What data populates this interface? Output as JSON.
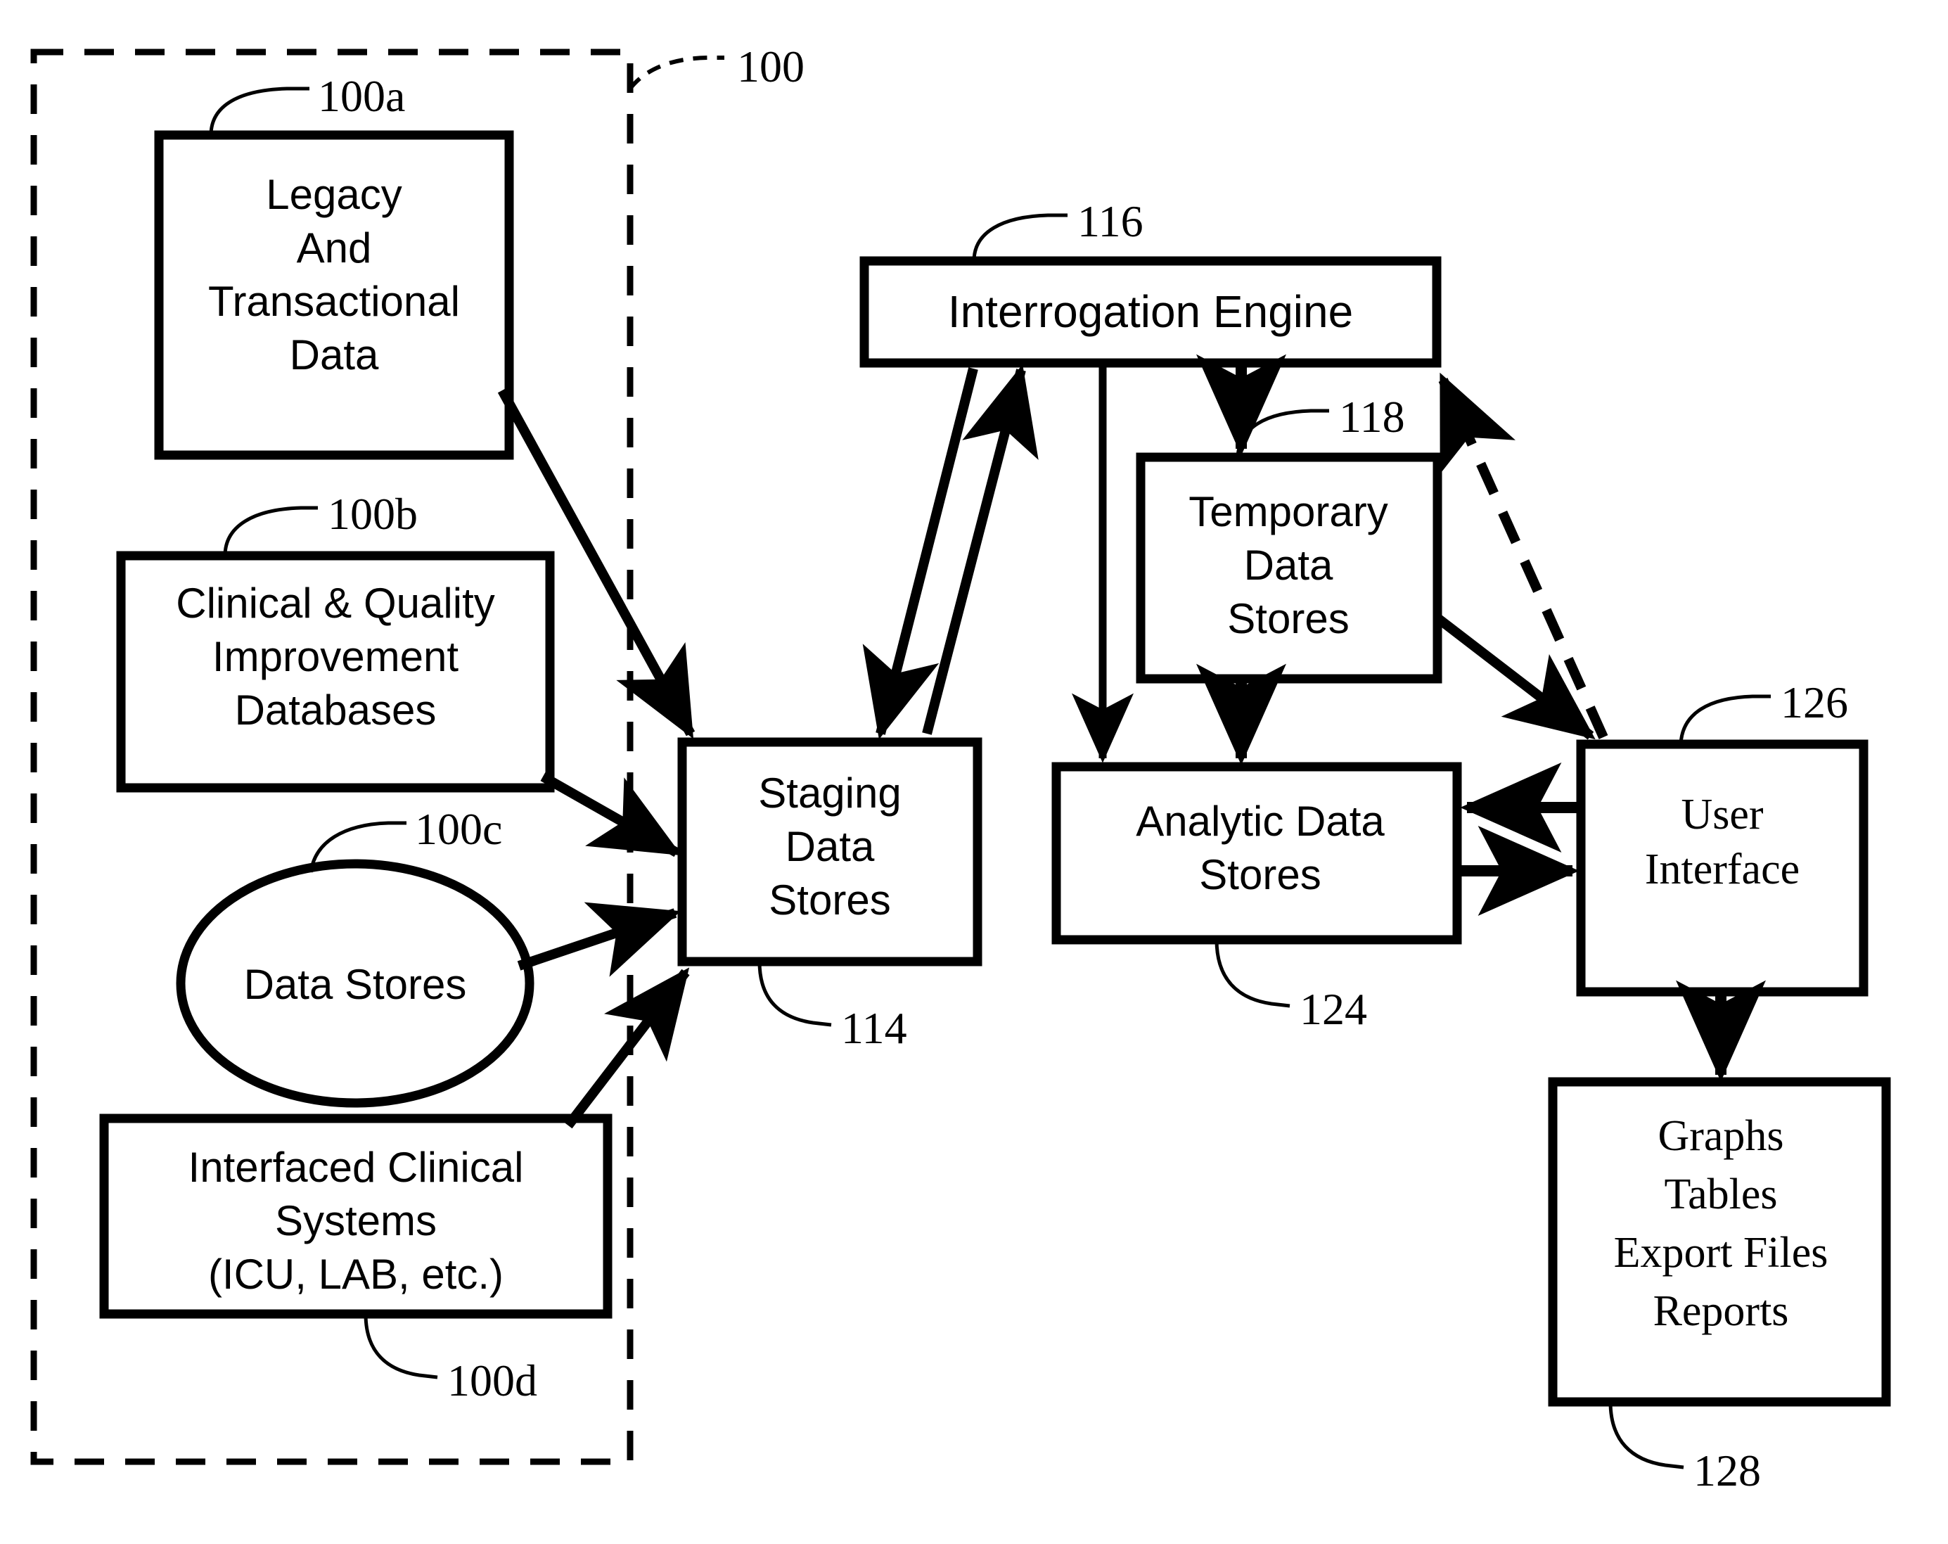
{
  "figure": {
    "type": "patent-block-diagram",
    "background": "#ffffff",
    "ink": "#000000"
  },
  "boundary": {
    "name": "data-sources-boundary",
    "style": "dashed",
    "ref": "100"
  },
  "nodes": {
    "legacy": {
      "ref": "100a",
      "shape": "rect",
      "lines": [
        "Legacy",
        "And",
        "Transactional",
        "Data"
      ]
    },
    "clinical_quality": {
      "ref": "100b",
      "shape": "rect",
      "lines": [
        "Clinical & Quality",
        "Improvement",
        "Databases"
      ]
    },
    "data_stores": {
      "ref": "100c",
      "shape": "ellipse",
      "lines": [
        "Data Stores"
      ]
    },
    "interfaced": {
      "ref": "100d",
      "shape": "rect",
      "lines": [
        "Interfaced Clinical",
        "Systems",
        "(ICU, LAB, etc.)"
      ]
    },
    "interrogation_engine": {
      "ref": "116",
      "shape": "rect",
      "lines": [
        "Interrogation Engine"
      ]
    },
    "staging": {
      "ref": "114",
      "shape": "rect",
      "lines": [
        "Staging",
        "Data",
        "Stores"
      ]
    },
    "temporary": {
      "ref": "118",
      "shape": "rect",
      "lines": [
        "Temporary",
        "Data",
        "Stores"
      ]
    },
    "analytic": {
      "ref": "124",
      "shape": "rect",
      "lines": [
        "Analytic Data",
        "Stores"
      ]
    },
    "user_interface": {
      "ref": "126",
      "shape": "rect",
      "lines": [
        "User",
        "Interface"
      ]
    },
    "outputs": {
      "ref": "128",
      "shape": "rect",
      "lines": [
        "Graphs",
        "Tables",
        "Export Files",
        "Reports"
      ]
    }
  },
  "refs": {
    "r100": "100",
    "r100a": "100a",
    "r100b": "100b",
    "r100c": "100c",
    "r100d": "100d",
    "r114": "114",
    "r116": "116",
    "r118": "118",
    "r124": "124",
    "r126": "126",
    "r128": "128"
  },
  "connections": [
    {
      "from": "legacy",
      "to": "staging",
      "style": "solid",
      "arrow": "end"
    },
    {
      "from": "clinical_quality",
      "to": "staging",
      "style": "solid",
      "arrow": "end"
    },
    {
      "from": "data_stores",
      "to": "staging",
      "style": "solid",
      "arrow": "end"
    },
    {
      "from": "interfaced",
      "to": "staging",
      "style": "solid",
      "arrow": "end"
    },
    {
      "from": "interrogation_engine",
      "to": "staging",
      "style": "solid",
      "arrow": "end"
    },
    {
      "from": "staging",
      "to": "interrogation_engine",
      "style": "solid",
      "arrow": "end"
    },
    {
      "from": "interrogation_engine",
      "to": "temporary",
      "style": "solid",
      "arrow": "end"
    },
    {
      "from": "interrogation_engine",
      "to": "analytic",
      "style": "solid",
      "arrow": "end"
    },
    {
      "from": "temporary",
      "to": "analytic",
      "style": "solid",
      "arrow": "end"
    },
    {
      "from": "temporary",
      "to": "user_interface",
      "style": "solid",
      "arrow": "end"
    },
    {
      "from": "user_interface",
      "to": "analytic",
      "style": "solid",
      "arrow": "end"
    },
    {
      "from": "analytic",
      "to": "user_interface",
      "style": "solid",
      "arrow": "end"
    },
    {
      "from": "user_interface",
      "to": "interrogation_engine",
      "style": "dashed",
      "arrow": "end"
    },
    {
      "from": "user_interface",
      "to": "outputs",
      "style": "solid",
      "arrow": "end"
    }
  ]
}
